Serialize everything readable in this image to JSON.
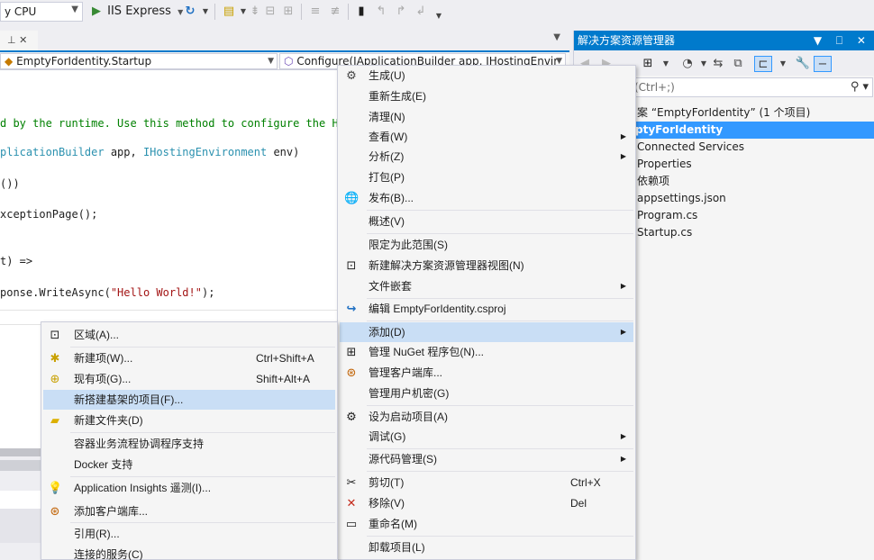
{
  "toolbar": {
    "platform": "y CPU",
    "run_label": "IIS Express"
  },
  "editor": {
    "tab_label": "⊥ ✕",
    "class_combo": "EmptyForIdentity.Startup",
    "method_combo": "Configure(IApplicationBuilder app, IHostingEnvir",
    "code": {
      "line1": "d by the runtime. Use this method to configure the HTTP",
      "line2_a": "plicationBuilder",
      "line2_b": " app, ",
      "line2_c": "IHostingEnvironment",
      "line2_d": " env)",
      "line3": "())",
      "line4": "xceptionPage();",
      "line5": "t) =>",
      "line6_a": "ponse.WriteAsync(",
      "line6_b": "\"Hello World!\"",
      "line6_c": ");"
    }
  },
  "solution_explorer": {
    "title": "解决方案资源管理器",
    "title_buttons": "▼ ⎕ ✕",
    "search_placeholder": "资源管理器(Ctrl+;)",
    "nodes": [
      {
        "label": "案 “EmptyForIdentity” (1 个项目)"
      },
      {
        "label": "ptyForIdentity"
      },
      {
        "label": "Connected Services"
      },
      {
        "label": "Properties"
      },
      {
        "label": "依赖项"
      },
      {
        "label": "appsettings.json"
      },
      {
        "label": "Program.cs"
      },
      {
        "label": "Startup.cs"
      }
    ]
  },
  "context_menu": {
    "items": [
      {
        "label": "生成(U)",
        "icon": "build-icon"
      },
      {
        "label": "重新生成(E)"
      },
      {
        "label": "清理(N)"
      },
      {
        "label": "查看(W)",
        "submenu": true
      },
      {
        "label": "分析(Z)",
        "submenu": true
      },
      {
        "label": "打包(P)"
      },
      {
        "label": "发布(B)...",
        "icon": "globe-icon"
      },
      {
        "label": "概述(V)"
      },
      {
        "label": "限定为此范围(S)"
      },
      {
        "label": "新建解决方案资源管理器视图(N)",
        "icon": "new-view-icon"
      },
      {
        "label": "文件嵌套",
        "submenu": true
      },
      {
        "label": "编辑 EmptyForIdentity.csproj",
        "icon": "edit-project-icon"
      },
      {
        "label": "添加(D)",
        "submenu": true
      },
      {
        "label": "管理 NuGet 程序包(N)...",
        "icon": "nuget-icon"
      },
      {
        "label": "管理客户端库...",
        "icon": "client-lib-icon"
      },
      {
        "label": "管理用户机密(G)"
      },
      {
        "label": "设为启动项目(A)",
        "icon": "gear-icon"
      },
      {
        "label": "调试(G)",
        "submenu": true
      },
      {
        "label": "源代码管理(S)",
        "submenu": true
      },
      {
        "label": "剪切(T)",
        "shortcut": "Ctrl+X",
        "icon": "scissors-icon"
      },
      {
        "label": "移除(V)",
        "shortcut": "Del",
        "icon": "remove-icon"
      },
      {
        "label": "重命名(M)",
        "icon": "rename-icon"
      },
      {
        "label": "卸载项目(L)"
      }
    ]
  },
  "add_submenu": {
    "items": [
      {
        "label": "区域(A)...",
        "icon": "area-icon"
      },
      {
        "label": "新建项(W)...",
        "shortcut": "Ctrl+Shift+A",
        "icon": "new-item-icon"
      },
      {
        "label": "现有项(G)...",
        "shortcut": "Shift+Alt+A",
        "icon": "existing-item-icon"
      },
      {
        "label": "新搭建基架的项目(F)..."
      },
      {
        "label": "新建文件夹(D)",
        "icon": "folder-icon"
      },
      {
        "label": "容器业务流程协调程序支持"
      },
      {
        "label": "Docker 支持"
      },
      {
        "label": "Application Insights 遥测(I)...",
        "icon": "insights-icon"
      },
      {
        "label": "添加客户端库...",
        "icon": "client-lib-icon"
      },
      {
        "label": "引用(R)..."
      },
      {
        "label": "连接的服务(C)"
      }
    ]
  }
}
